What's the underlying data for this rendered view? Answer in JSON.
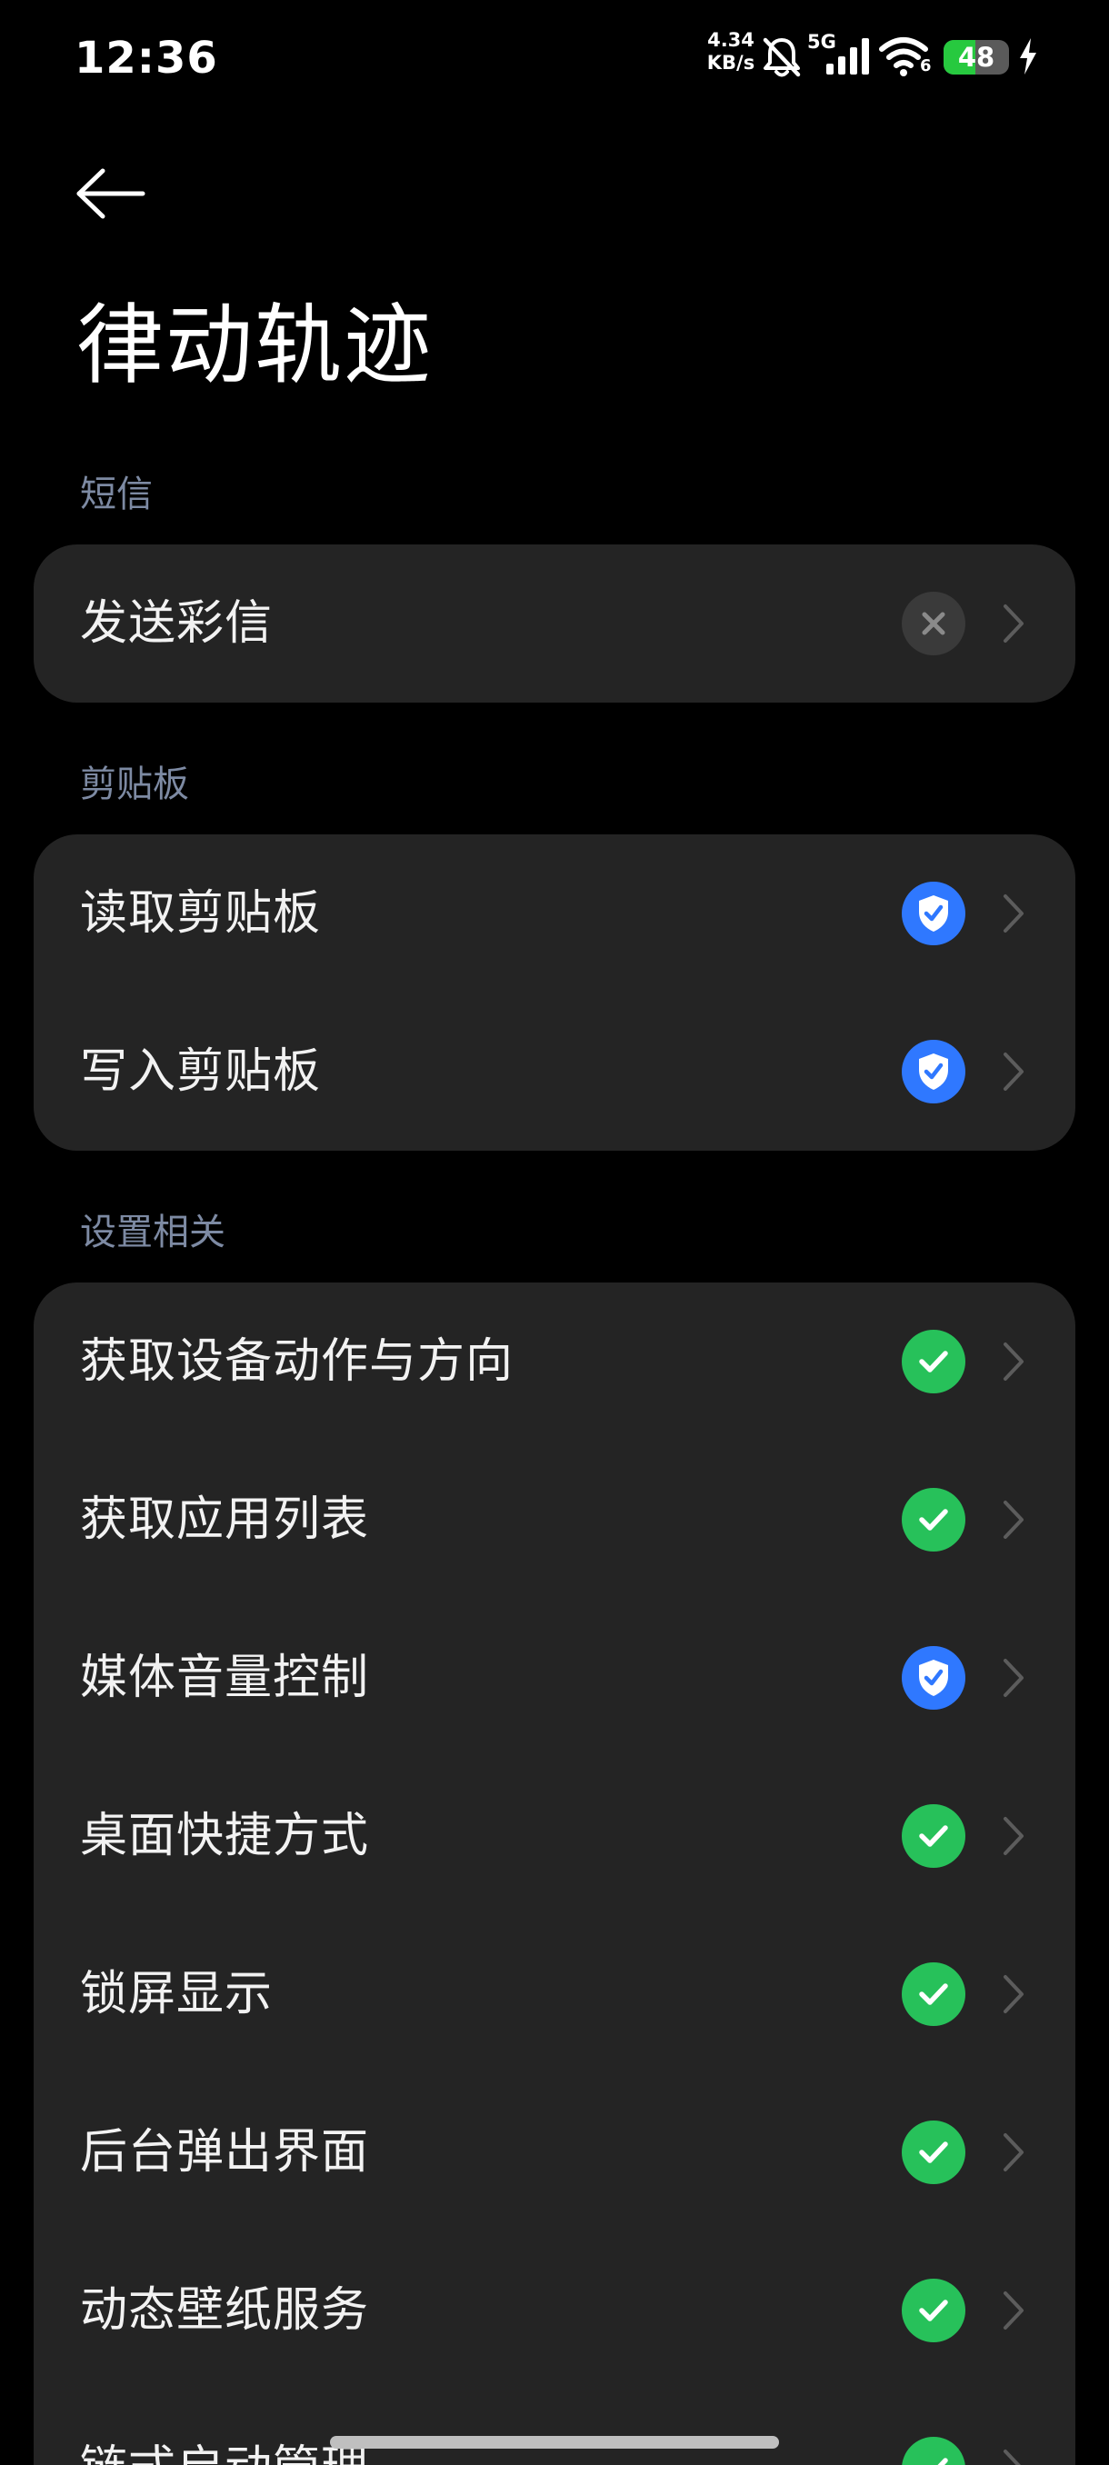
{
  "status_bar": {
    "time": "12:36",
    "net_speed_value": "4.34",
    "net_speed_unit": "KB/s",
    "network_type": "5G",
    "wifi_badge": "6",
    "battery_level": "48",
    "battery_fraction": 0.48,
    "icons": [
      "mute-bell-icon",
      "signal-icon",
      "wifi-icon",
      "battery-icon",
      "charging-icon"
    ]
  },
  "header": {
    "back_icon": "arrow-left-icon",
    "title": "律动轨迹"
  },
  "colors": {
    "background": "#000000",
    "card": "#242424",
    "section_label": "#7d8aa3",
    "allowed_green": "#27c15a",
    "ask_blue": "#2f78ff",
    "denied_gray": "#3a3a3a",
    "battery_green": "#27c93f"
  },
  "sections": [
    {
      "label": "短信",
      "items": [
        {
          "label": "发送彩信",
          "status": "denied",
          "status_icon": "x-icon"
        }
      ]
    },
    {
      "label": "剪贴板",
      "items": [
        {
          "label": "读取剪贴板",
          "status": "ask",
          "status_icon": "shield-check-icon"
        },
        {
          "label": "写入剪贴板",
          "status": "ask",
          "status_icon": "shield-check-icon"
        }
      ]
    },
    {
      "label": "设置相关",
      "items": [
        {
          "label": "获取设备动作与方向",
          "status": "allowed",
          "status_icon": "check-icon"
        },
        {
          "label": "获取应用列表",
          "status": "allowed",
          "status_icon": "check-icon"
        },
        {
          "label": "媒体音量控制",
          "status": "ask",
          "status_icon": "shield-check-icon"
        },
        {
          "label": "桌面快捷方式",
          "status": "allowed",
          "status_icon": "check-icon"
        },
        {
          "label": "锁屏显示",
          "status": "allowed",
          "status_icon": "check-icon"
        },
        {
          "label": "后台弹出界面",
          "status": "allowed",
          "status_icon": "check-icon"
        },
        {
          "label": "动态壁纸服务",
          "status": "allowed",
          "status_icon": "check-icon"
        },
        {
          "label": "链式启动管理",
          "status": "allowed",
          "status_icon": "check-icon"
        }
      ]
    }
  ]
}
